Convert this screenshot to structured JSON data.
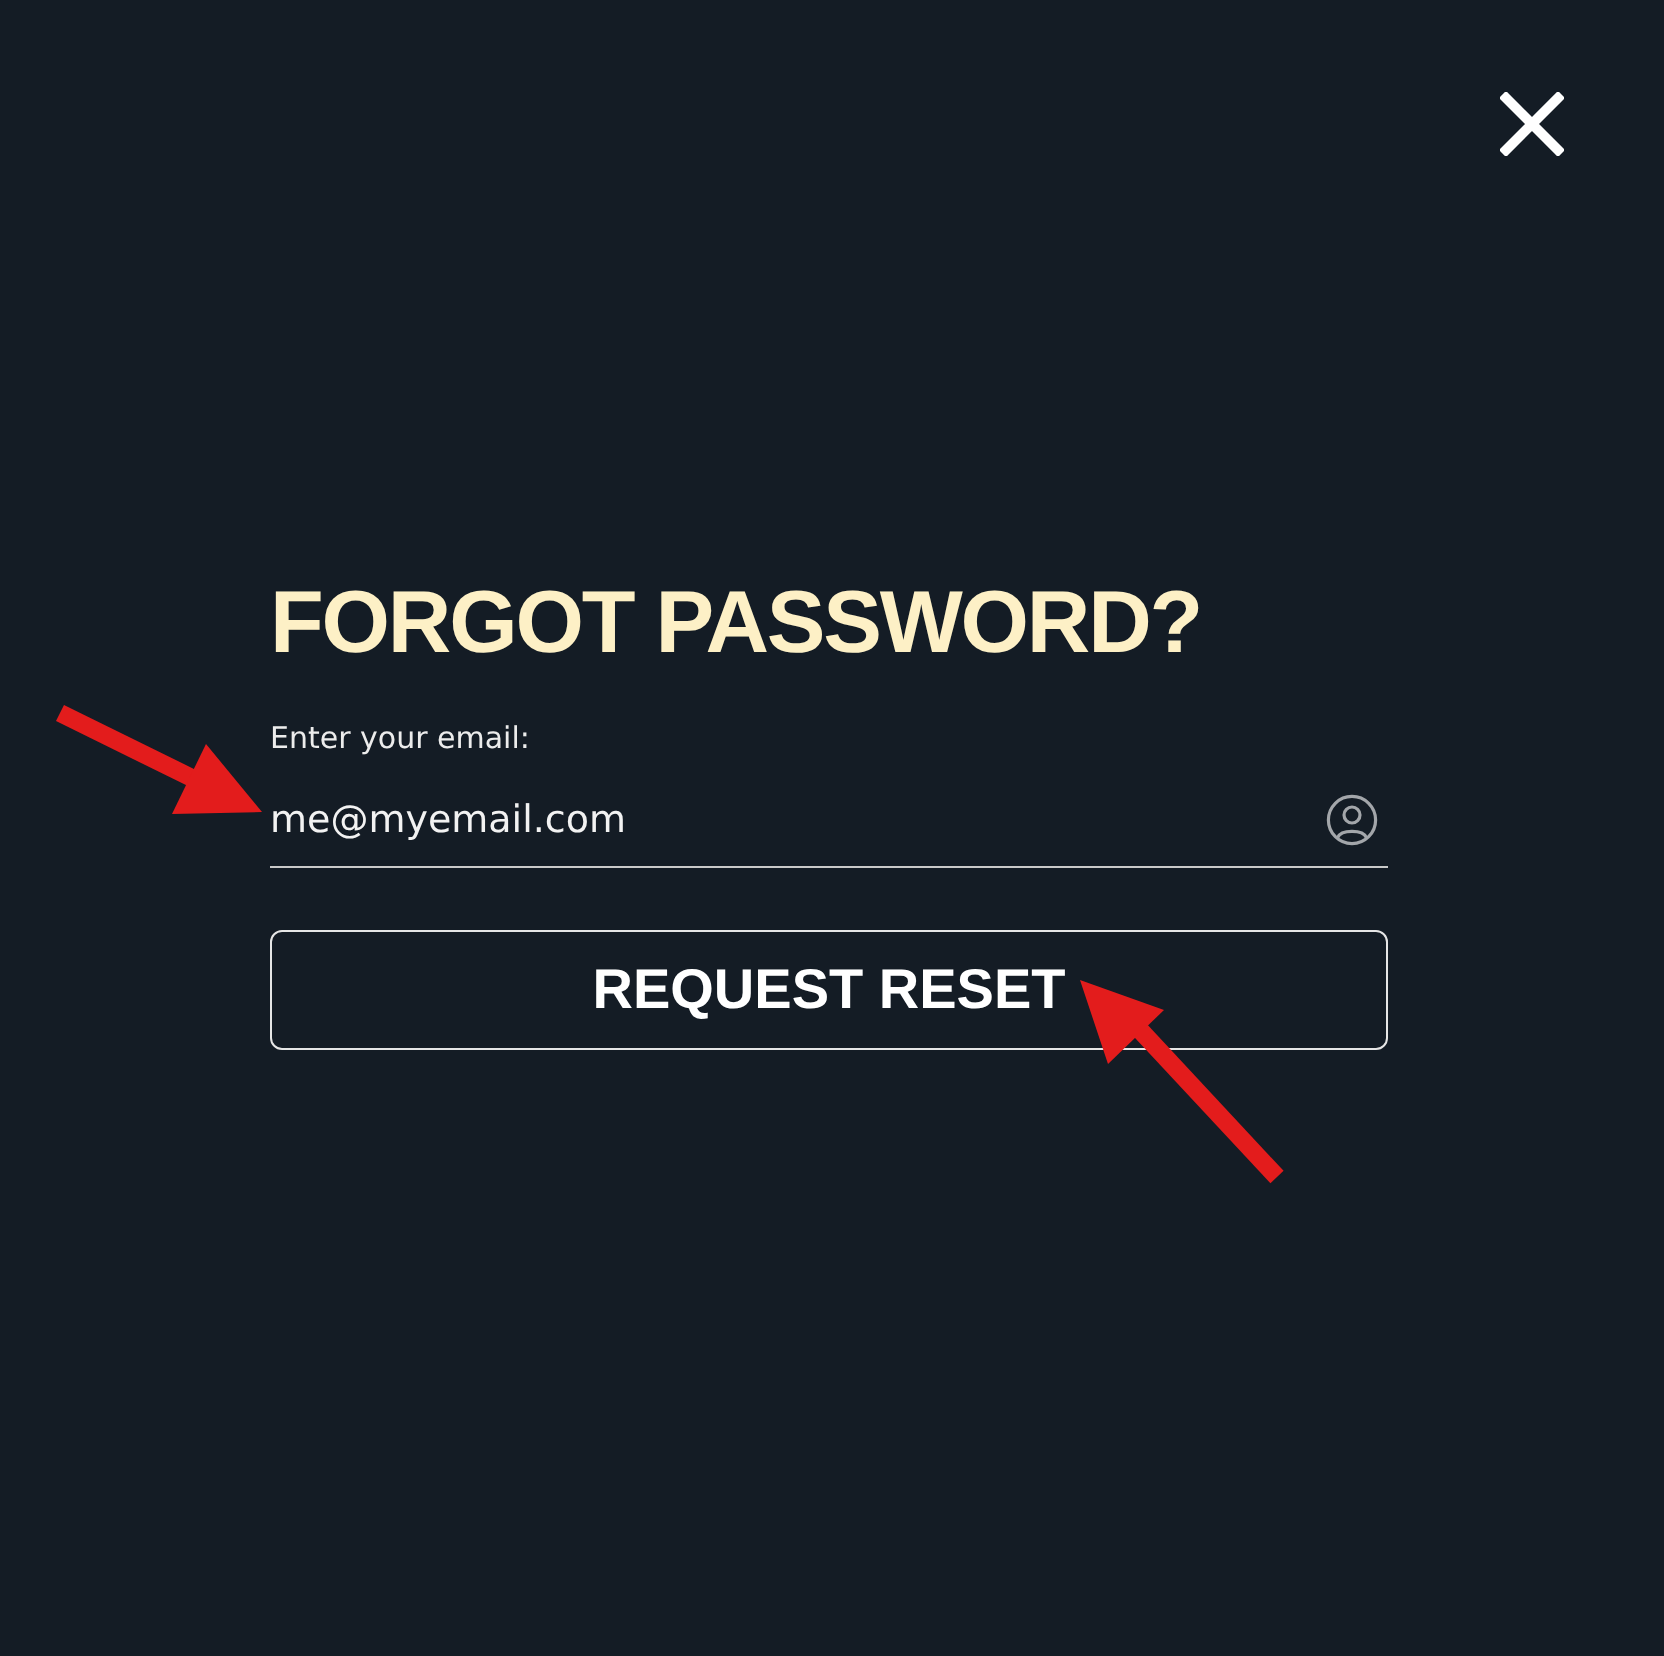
{
  "title": "FORGOT PASSWORD?",
  "email_field": {
    "label": "Enter your email:",
    "value": "me@myemail.com"
  },
  "submit_button": {
    "label": "REQUEST RESET"
  }
}
